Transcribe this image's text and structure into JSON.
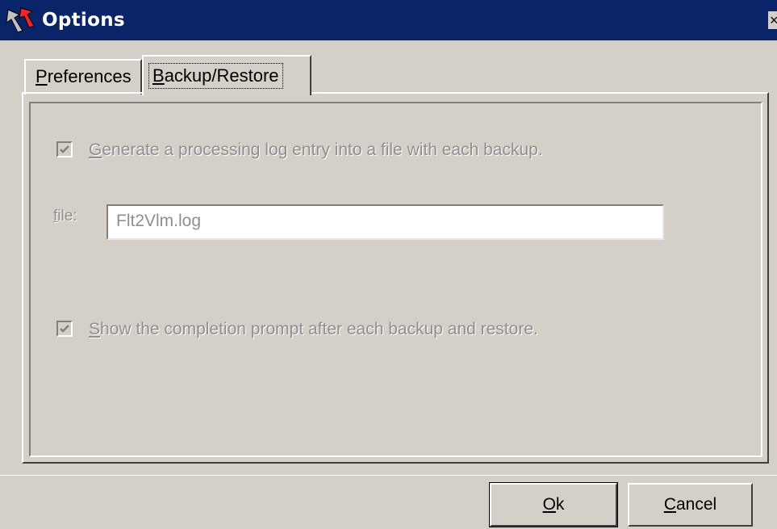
{
  "window": {
    "title": "Options",
    "close_glyph": "×"
  },
  "tabs": [
    {
      "mnemonic": "P",
      "rest": "references",
      "selected": false
    },
    {
      "mnemonic": "B",
      "rest": "ackup/Restore",
      "selected": true
    }
  ],
  "backup_restore": {
    "log_checkbox": {
      "checked": true,
      "enabled": false,
      "mnemonic": "G",
      "label_rest": "enerate a processing log entry into a file with each backup."
    },
    "file_field": {
      "label_mnemonic": "f",
      "label_rest": "ile:",
      "value": "Flt2Vlm.log",
      "enabled": false
    },
    "prompt_checkbox": {
      "checked": true,
      "enabled": false,
      "mnemonic": "S",
      "label_rest": "how the completion prompt after each backup and restore."
    }
  },
  "buttons": {
    "ok": {
      "mnemonic": "O",
      "rest": "k"
    },
    "cancel": {
      "mnemonic": "C",
      "rest": "ancel"
    }
  },
  "icons": {
    "title_icon": "app-icon",
    "check_mark": "check-icon"
  },
  "colors": {
    "titlebar": "#0a246a",
    "face": "#d4d0c8",
    "disabled_text": "#8f8f8f"
  }
}
